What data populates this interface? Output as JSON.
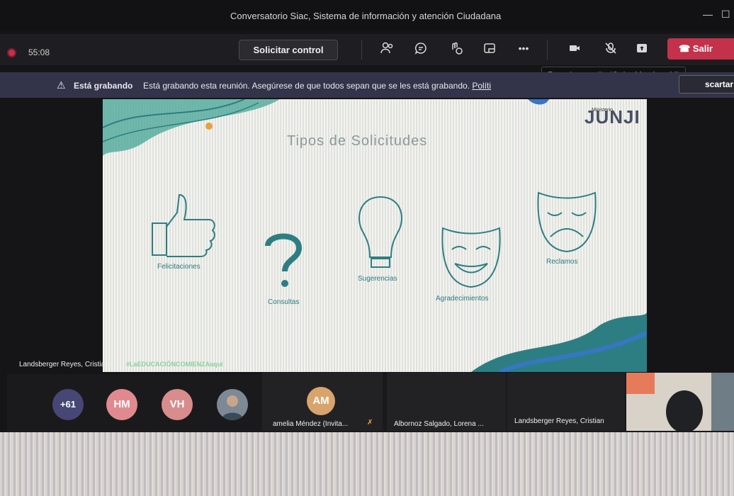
{
  "window": {
    "title": "Conversatorio Siac, Sistema de información y atención Ciudadana"
  },
  "toolbar": {
    "timer": "55:08",
    "request_control_label": "Solicitar control",
    "more_label": "•••",
    "leave_label": "Salir",
    "tooltip": "Reactivar audio (Ctrl + Mayús + M)"
  },
  "banner": {
    "bold": "Está grabando",
    "text": "Está grabando esta reunión. Asegúrese de que todos sepan que se les está grabando.",
    "link": "Políti",
    "dismiss_label": "scartar"
  },
  "slide": {
    "title": "Tipos de Solicitudes",
    "brand": "JUNJI",
    "ministry": "Ministerio",
    "hashtag": "#LaEDUCACIÓNCOMIENZAaquí",
    "items": [
      {
        "label": "Felicitaciones",
        "icon": "thumbs-up-icon"
      },
      {
        "label": "Consultas",
        "icon": "question-mark-icon"
      },
      {
        "label": "Sugerencias",
        "icon": "lightbulb-icon"
      },
      {
        "label": "Agradecimientos",
        "icon": "comedy-mask-icon"
      },
      {
        "label": "Reclamos",
        "icon": "tragedy-mask-icon"
      }
    ]
  },
  "presenter": "Landsberger Reyes, Cristian",
  "participants": {
    "overflow": "+61",
    "avatars": [
      {
        "initials": "HM",
        "color": "#e08a8f"
      },
      {
        "initials": "VH",
        "color": "#d88c8c"
      }
    ],
    "tiles": [
      {
        "initials": "AM",
        "name": "amelia Méndez (Invita..."
      },
      {
        "name": "Albornoz Salgado, Lorena ..."
      },
      {
        "name": "Landsberger Reyes, Cristian"
      }
    ]
  },
  "colors": {
    "accent": "#c4314b",
    "banner": "#33344a",
    "overflow_avatar": "#464775",
    "slide_teal": "#2d7e82"
  }
}
